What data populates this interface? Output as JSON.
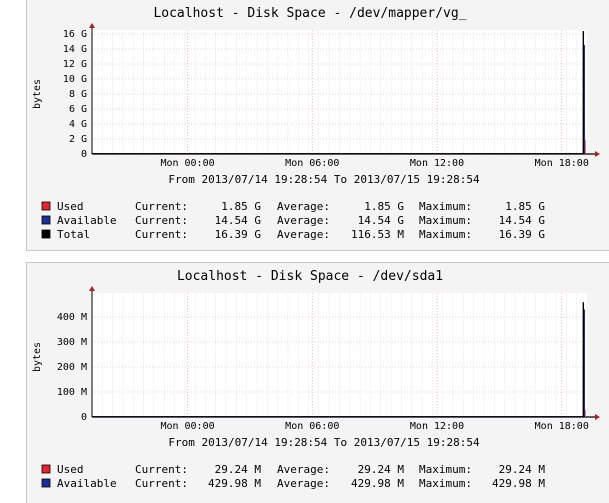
{
  "chart_data": [
    {
      "type": "area",
      "title": "Localhost - Disk Space - /dev/mapper/vg_",
      "ylabel": "bytes",
      "ylim": [
        0,
        16
      ],
      "yticks": [
        "0",
        "2 G",
        "4 G",
        "6 G",
        "8 G",
        "10 G",
        "12 G",
        "14 G",
        "16 G"
      ],
      "xticks": [
        "Mon 00:00",
        "Mon 06:00",
        "Mon 12:00",
        "Mon 18:00"
      ],
      "x": [
        "Mon 00:00",
        "Mon 06:00",
        "Mon 12:00",
        "Mon 18:00"
      ],
      "series": [
        {
          "name": "Used",
          "color": "#e8222e",
          "values": [
            0,
            0,
            0,
            1.85
          ]
        },
        {
          "name": "Available",
          "color": "#1b2f99",
          "values": [
            0,
            0,
            0,
            14.54
          ]
        },
        {
          "name": "Total",
          "color": "#000000",
          "values": [
            0,
            0,
            0,
            16.39
          ]
        }
      ],
      "range_text": "From 2013/07/14 19:28:54 To 2013/07/15 19:28:54",
      "legend": [
        {
          "name": "Used",
          "color": "#e8222e",
          "current": "1.85 G",
          "average": "1.85 G",
          "maximum": "1.85 G"
        },
        {
          "name": "Available",
          "color": "#1b2f99",
          "current": "14.54 G",
          "average": "14.54 G",
          "maximum": "14.54 G"
        },
        {
          "name": "Total",
          "color": "#000000",
          "current": "16.39 G",
          "average": "116.53 M",
          "maximum": "16.39 G"
        }
      ]
    },
    {
      "type": "area",
      "title": "Localhost - Disk Space - /dev/sda1",
      "ylabel": "bytes",
      "ylim": [
        0,
        480
      ],
      "yticks": [
        "0",
        "100 M",
        "200 M",
        "300 M",
        "400 M"
      ],
      "xticks": [
        "Mon 00:00",
        "Mon 06:00",
        "Mon 12:00",
        "Mon 18:00"
      ],
      "x": [
        "Mon 00:00",
        "Mon 06:00",
        "Mon 12:00",
        "Mon 18:00"
      ],
      "series": [
        {
          "name": "Used",
          "color": "#e8222e",
          "values": [
            0,
            0,
            0,
            29.24
          ]
        },
        {
          "name": "Available",
          "color": "#1b2f99",
          "values": [
            0,
            0,
            0,
            429.98
          ]
        },
        {
          "name": "Total",
          "color": "#000000",
          "values": [
            0,
            0,
            0,
            459.22
          ]
        }
      ],
      "range_text": "From 2013/07/14 19:28:54 To 2013/07/15 19:28:54",
      "legend": [
        {
          "name": "Used",
          "color": "#e8222e",
          "current": "29.24 M",
          "average": "29.24 M",
          "maximum": "29.24 M"
        },
        {
          "name": "Available",
          "color": "#1b2f99",
          "current": "429.98 M",
          "average": "429.98 M",
          "maximum": "429.98 M"
        }
      ]
    }
  ],
  "labels": {
    "current": "Current:",
    "average": "Average:",
    "maximum": "Maximum:"
  }
}
